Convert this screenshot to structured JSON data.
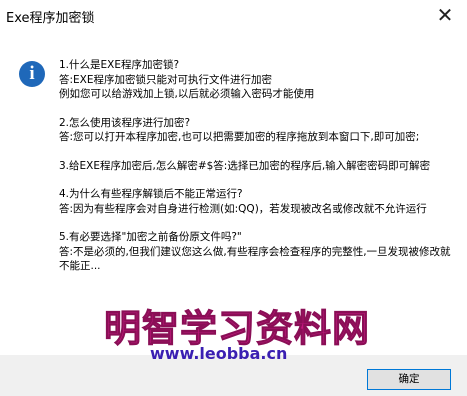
{
  "window": {
    "title": "Exe程序加密锁",
    "close_glyph": "✕"
  },
  "icon": {
    "name": "info-icon",
    "glyph": "i",
    "color": "#1f68b9"
  },
  "faq": [
    {
      "question": "1.什么是EXE程序加密锁?",
      "answer": "答:EXE程序加密锁只能对可执行文件进行加密\n例如您可以给游戏加上锁,以后就必须输入密码才能使用"
    },
    {
      "question": "2.怎么使用该程序进行加密?",
      "answer": "答:您可以打开本程序加密,也可以把需要加密的程序拖放到本窗口下,即可加密;"
    },
    {
      "question": "",
      "answer": "3.给EXE程序加密后,怎么解密#$答:选择已加密的程序后,输入解密密码即可解密"
    },
    {
      "question": "4.为什么有些程序解锁后不能正常运行?",
      "answer": "答:因为有些程序会对自身进行检测(如:QQ)，若发现被改名或修改就不允许运行"
    },
    {
      "question": "5.有必要选择\"加密之前备份原文件吗?\"",
      "answer": "答:不是必须的,但我们建议您这么做,有些程序会检查程序的完整性,一旦发现被修改就不能正..."
    }
  ],
  "buttons": {
    "ok_label": "确定"
  },
  "watermark": {
    "text": "明智学习资料网",
    "url": "www.leobba.cn",
    "text_color": "#c2177e",
    "url_color": "#3a1fb2"
  },
  "colors": {
    "window_bg": "#ffffff",
    "footer_bg": "#f0f0f0",
    "button_border": "#0078d7"
  }
}
